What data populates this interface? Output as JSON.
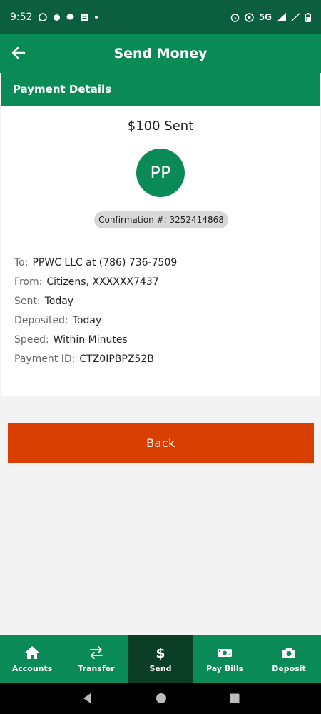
{
  "status_bar": {
    "time": "9:52",
    "network": "5G"
  },
  "app_bar": {
    "title": "Send Money"
  },
  "section": {
    "title": "Payment Details"
  },
  "payment": {
    "amount_text": "$100 Sent",
    "avatar_initials": "PP",
    "confirmation": "Confirmation #: 3252414868",
    "details": [
      {
        "label": "To:",
        "value": "PPWC LLC at (786) 736-7509"
      },
      {
        "label": "From:",
        "value": "Citizens, XXXXXX7437"
      },
      {
        "label": "Sent:",
        "value": "Today"
      },
      {
        "label": "Deposited:",
        "value": "Today"
      },
      {
        "label": "Speed:",
        "value": "Within Minutes"
      },
      {
        "label": "Payment ID:",
        "value": "CTZ0IPBPZ52B"
      }
    ]
  },
  "actions": {
    "back_label": "Back"
  },
  "bottom_nav": {
    "items": [
      {
        "label": "Accounts",
        "icon": "home-icon"
      },
      {
        "label": "Transfer",
        "icon": "transfer-arrows-icon"
      },
      {
        "label": "Send",
        "icon": "dollar-icon",
        "active": true
      },
      {
        "label": "Pay Bills",
        "icon": "bill-icon"
      },
      {
        "label": "Deposit",
        "icon": "camera-icon"
      }
    ]
  },
  "colors": {
    "primary": "#0a8a57",
    "status_bar": "#0b5f3f",
    "active_nav": "#0b3d27",
    "button": "#d93f00"
  }
}
